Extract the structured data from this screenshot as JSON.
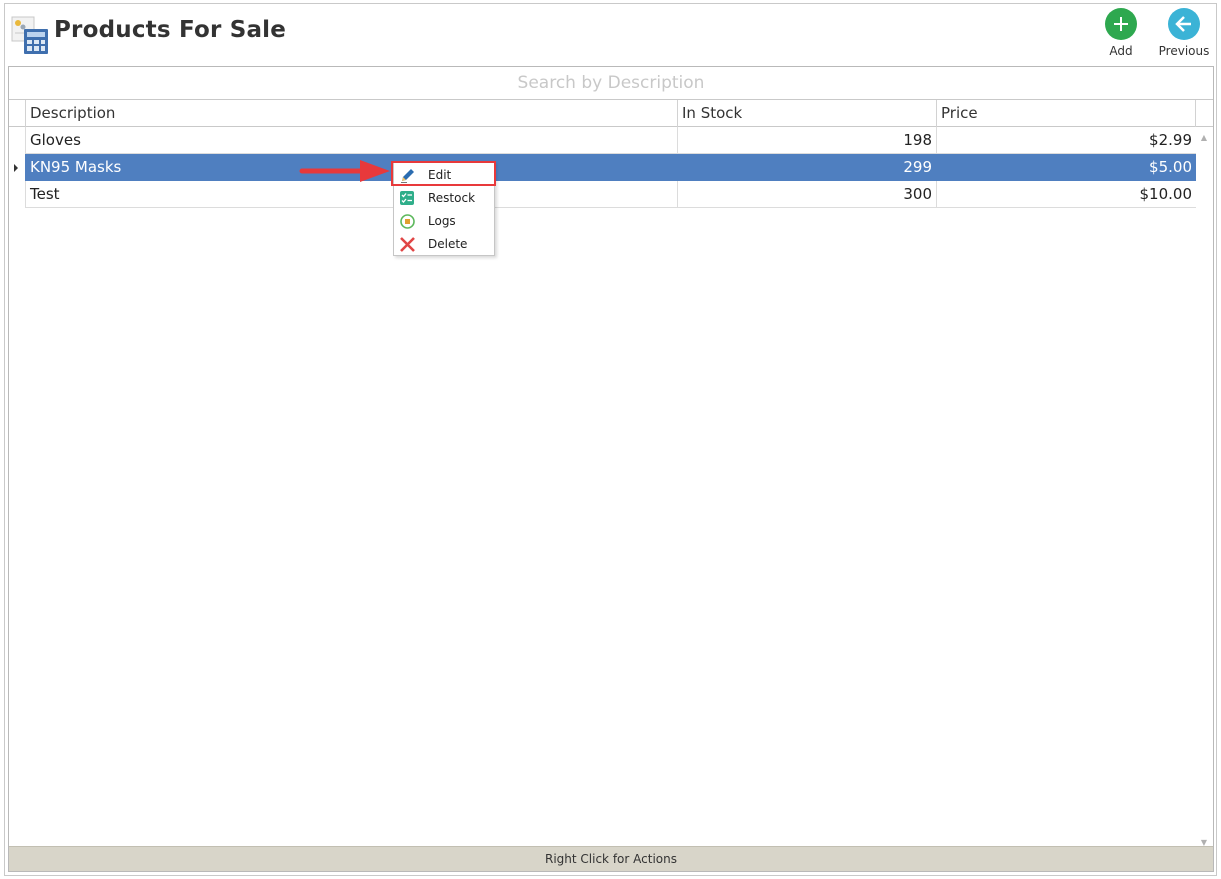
{
  "window": {
    "title": "Products For Sale"
  },
  "toolbar": {
    "add_label": "Add",
    "previous_label": "Previous",
    "add_icon": "plus-circle-icon",
    "previous_icon": "back-arrow-circle-icon"
  },
  "search": {
    "placeholder": "Search by Description",
    "value": ""
  },
  "table": {
    "columns": [
      "Description",
      "In Stock",
      "Price"
    ],
    "rows": [
      {
        "description": "Gloves",
        "in_stock": "198",
        "price": "$2.99"
      },
      {
        "description": "KN95 Masks",
        "in_stock": "299",
        "price": "$5.00"
      },
      {
        "description": "Test",
        "in_stock": "300",
        "price": "$10.00"
      }
    ],
    "selected_row": 1
  },
  "context_menu": {
    "items": [
      {
        "label": "Edit",
        "icon": "pencil-icon"
      },
      {
        "label": "Restock",
        "icon": "restock-checklist-icon"
      },
      {
        "label": "Logs",
        "icon": "logs-refresh-icon"
      },
      {
        "label": "Delete",
        "icon": "delete-x-icon"
      }
    ],
    "highlighted_item": "Edit"
  },
  "status_bar": {
    "text": "Right Click for Actions"
  },
  "colors": {
    "selection": "#4f7fc0",
    "add_button": "#2ea84f",
    "previous_button": "#3bb3d6",
    "annotation": "#e8393b",
    "status_bar_bg": "#d8d5c9"
  }
}
